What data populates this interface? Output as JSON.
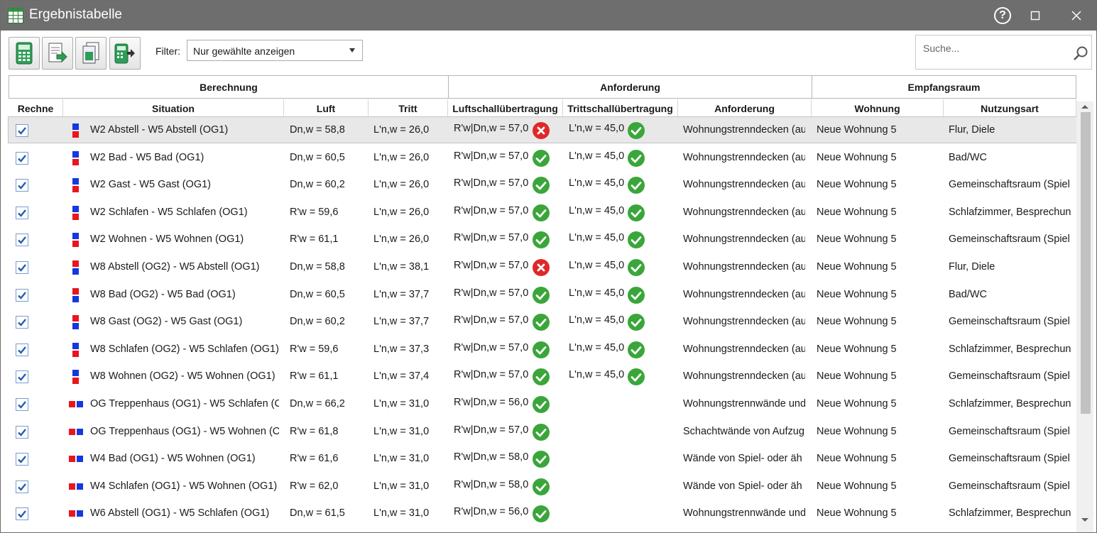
{
  "window": {
    "title": "Ergebnistabelle",
    "help": "?"
  },
  "toolbar": {
    "filter_label": "Filter:",
    "filter_value": "Nur gewählte anzeigen",
    "search_placeholder": "Suche..."
  },
  "groups": {
    "berechnung": "Berechnung",
    "anforderung": "Anforderung",
    "empfangsraum": "Empfangsraum"
  },
  "columns": {
    "rechne": "Rechne",
    "situation": "Situation",
    "luft": "Luft",
    "tritt": "Tritt",
    "luftschall": "Luftschallübertragung",
    "trittschall": "Trittschallübertragung",
    "anforderung": "Anforderung",
    "wohnung": "Wohnung",
    "nutzungsart": "Nutzungsart"
  },
  "colors": {
    "ok": "#3aa63a",
    "fail": "#e02828",
    "icon_red": "#e8161e",
    "icon_blue": "#1438e0"
  },
  "rows": [
    {
      "checked": true,
      "icon": "stacked",
      "situation": "W2 Abstell - W5 Abstell (OG1)",
      "luft": "Dn,w = 58,8",
      "tritt": "L'n,w = 26,0",
      "luftschall": "R'w|Dn,w = 57,0",
      "luft_ok": false,
      "trittschall": "L'n,w = 45,0",
      "tritt_ok": true,
      "anforderung": "Wohnungstrenndecken (au",
      "wohnung": "Neue Wohnung 5",
      "nutzungsart": "Flur, Diele"
    },
    {
      "checked": true,
      "icon": "stacked",
      "situation": "W2 Bad - W5 Bad (OG1)",
      "luft": "Dn,w = 60,5",
      "tritt": "L'n,w = 26,0",
      "luftschall": "R'w|Dn,w = 57,0",
      "luft_ok": true,
      "trittschall": "L'n,w = 45,0",
      "tritt_ok": true,
      "anforderung": "Wohnungstrenndecken (au",
      "wohnung": "Neue Wohnung 5",
      "nutzungsart": "Bad/WC"
    },
    {
      "checked": true,
      "icon": "stacked",
      "situation": "W2 Gast - W5 Gast (OG1)",
      "luft": "Dn,w = 60,2",
      "tritt": "L'n,w = 26,0",
      "luftschall": "R'w|Dn,w = 57,0",
      "luft_ok": true,
      "trittschall": "L'n,w = 45,0",
      "tritt_ok": true,
      "anforderung": "Wohnungstrenndecken (au",
      "wohnung": "Neue Wohnung 5",
      "nutzungsart": "Gemeinschaftsraum (Spiel"
    },
    {
      "checked": true,
      "icon": "stacked",
      "situation": "W2 Schlafen - W5 Schlafen (OG1)",
      "luft": "R'w = 59,6",
      "tritt": "L'n,w = 26,0",
      "luftschall": "R'w|Dn,w = 57,0",
      "luft_ok": true,
      "trittschall": "L'n,w = 45,0",
      "tritt_ok": true,
      "anforderung": "Wohnungstrenndecken (au",
      "wohnung": "Neue Wohnung 5",
      "nutzungsart": "Schlafzimmer, Besprechun"
    },
    {
      "checked": true,
      "icon": "stacked",
      "situation": "W2 Wohnen - W5 Wohnen (OG1)",
      "luft": "R'w = 61,1",
      "tritt": "L'n,w = 26,0",
      "luftschall": "R'w|Dn,w = 57,0",
      "luft_ok": true,
      "trittschall": "L'n,w = 45,0",
      "tritt_ok": true,
      "anforderung": "Wohnungstrenndecken (au",
      "wohnung": "Neue Wohnung 5",
      "nutzungsart": "Gemeinschaftsraum (Spiel"
    },
    {
      "checked": true,
      "icon": "stacked2",
      "situation": "W8 Abstell (OG2) - W5 Abstell (OG1)",
      "luft": "Dn,w = 58,8",
      "tritt": "L'n,w = 38,1",
      "luftschall": "R'w|Dn,w = 57,0",
      "luft_ok": false,
      "trittschall": "L'n,w = 45,0",
      "tritt_ok": true,
      "anforderung": "Wohnungstrenndecken (au",
      "wohnung": "Neue Wohnung 5",
      "nutzungsart": "Flur, Diele"
    },
    {
      "checked": true,
      "icon": "stacked2",
      "situation": "W8 Bad (OG2) - W5 Bad (OG1)",
      "luft": "Dn,w = 60,5",
      "tritt": "L'n,w = 37,7",
      "luftschall": "R'w|Dn,w = 57,0",
      "luft_ok": true,
      "trittschall": "L'n,w = 45,0",
      "tritt_ok": true,
      "anforderung": "Wohnungstrenndecken (au",
      "wohnung": "Neue Wohnung 5",
      "nutzungsart": "Bad/WC"
    },
    {
      "checked": true,
      "icon": "stacked2",
      "situation": "W8 Gast (OG2) - W5 Gast (OG1)",
      "luft": "Dn,w = 60,2",
      "tritt": "L'n,w = 37,7",
      "luftschall": "R'w|Dn,w = 57,0",
      "luft_ok": true,
      "trittschall": "L'n,w = 45,0",
      "tritt_ok": true,
      "anforderung": "Wohnungstrenndecken (au",
      "wohnung": "Neue Wohnung 5",
      "nutzungsart": "Gemeinschaftsraum (Spiel"
    },
    {
      "checked": true,
      "icon": "stacked",
      "situation": "W8 Schlafen (OG2) - W5 Schlafen (OG1)",
      "luft": "R'w = 59,6",
      "tritt": "L'n,w = 37,3",
      "luftschall": "R'w|Dn,w = 57,0",
      "luft_ok": true,
      "trittschall": "L'n,w = 45,0",
      "tritt_ok": true,
      "anforderung": "Wohnungstrenndecken (au",
      "wohnung": "Neue Wohnung 5",
      "nutzungsart": "Schlafzimmer, Besprechun"
    },
    {
      "checked": true,
      "icon": "stacked",
      "situation": "W8 Wohnen (OG2) - W5 Wohnen (OG1)",
      "luft": "R'w = 61,1",
      "tritt": "L'n,w = 37,4",
      "luftschall": "R'w|Dn,w = 57,0",
      "luft_ok": true,
      "trittschall": "L'n,w = 45,0",
      "tritt_ok": true,
      "anforderung": "Wohnungstrenndecken (au",
      "wohnung": "Neue Wohnung 5",
      "nutzungsart": "Gemeinschaftsraum (Spiel"
    },
    {
      "checked": true,
      "icon": "side",
      "situation": "OG Treppenhaus (OG1) - W5 Schlafen (C",
      "luft": "Dn,w = 66,2",
      "tritt": "L'n,w = 31,0",
      "luftschall": "R'w|Dn,w = 56,0",
      "luft_ok": true,
      "trittschall": "",
      "tritt_ok": null,
      "anforderung": "Wohnungstrennwände und",
      "wohnung": "Neue Wohnung 5",
      "nutzungsart": "Schlafzimmer, Besprechun"
    },
    {
      "checked": true,
      "icon": "side",
      "situation": "OG Treppenhaus (OG1) - W5 Wohnen (C",
      "luft": "R'w = 61,8",
      "tritt": "L'n,w = 31,0",
      "luftschall": "R'w|Dn,w = 57,0",
      "luft_ok": true,
      "trittschall": "",
      "tritt_ok": null,
      "anforderung": "Schachtwände von Aufzug",
      "wohnung": "Neue Wohnung 5",
      "nutzungsart": "Gemeinschaftsraum (Spiel"
    },
    {
      "checked": true,
      "icon": "side",
      "situation": "W4 Bad (OG1) - W5 Wohnen (OG1)",
      "luft": "R'w = 61,6",
      "tritt": "L'n,w = 31,0",
      "luftschall": "R'w|Dn,w = 58,0",
      "luft_ok": true,
      "trittschall": "",
      "tritt_ok": null,
      "anforderung": "Wände von Spiel- oder äh",
      "wohnung": "Neue Wohnung 5",
      "nutzungsart": "Gemeinschaftsraum (Spiel"
    },
    {
      "checked": true,
      "icon": "side",
      "situation": "W4 Schlafen (OG1) - W5 Wohnen (OG1)",
      "luft": "R'w = 62,0",
      "tritt": "L'n,w = 31,0",
      "luftschall": "R'w|Dn,w = 58,0",
      "luft_ok": true,
      "trittschall": "",
      "tritt_ok": null,
      "anforderung": "Wände von Spiel- oder äh",
      "wohnung": "Neue Wohnung 5",
      "nutzungsart": "Gemeinschaftsraum (Spiel"
    },
    {
      "checked": true,
      "icon": "side",
      "situation": "W6 Abstell (OG1) - W5 Schlafen (OG1)",
      "luft": "Dn,w = 61,5",
      "tritt": "L'n,w = 31,0",
      "luftschall": "R'w|Dn,w = 56,0",
      "luft_ok": true,
      "trittschall": "",
      "tritt_ok": null,
      "anforderung": "Wohnungstrennwände und",
      "wohnung": "Neue Wohnung 5",
      "nutzungsart": "Schlafzimmer, Besprechun"
    }
  ]
}
